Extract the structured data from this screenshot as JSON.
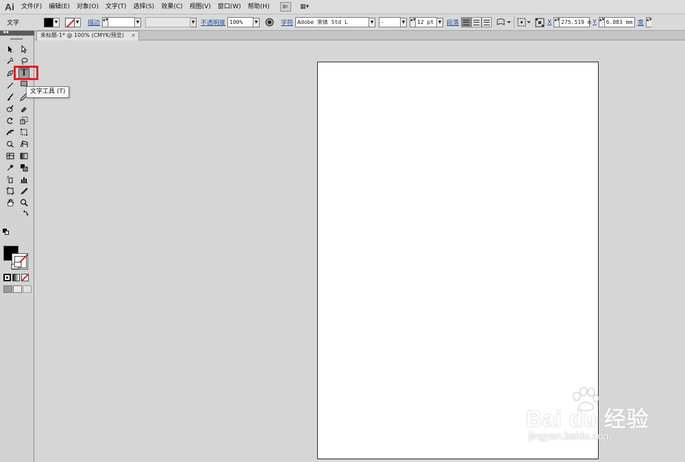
{
  "app": {
    "logo": "Ai"
  },
  "menu": {
    "items": [
      "文件(F)",
      "编辑(E)",
      "对象(O)",
      "文字(T)",
      "选择(S)",
      "效果(C)",
      "视图(V)",
      "窗口(W)",
      "帮助(H)"
    ],
    "bridge_icon": "Br",
    "workspace_icon": "▦▾"
  },
  "control": {
    "tool_label": "文字",
    "stroke_label": "描边",
    "stroke_arrows": "▲▼",
    "opacity_label": "不透明度",
    "opacity_value": "100%",
    "char_label": "字符",
    "font_family": "Adobe 宋体 Std L",
    "font_style": "-",
    "font_size": "12 pt",
    "paragraph_label": "段落",
    "x_label": "X",
    "x_value": "275.519 m",
    "y_label": "Y",
    "y_value": "6.083 mm",
    "w_label": "宽"
  },
  "document": {
    "tab_title": "未标题-1* @ 100% (CMYK/预览)",
    "close_glyph": "×"
  },
  "tools_panel": {
    "collapse_glyph": "◂◂",
    "type_tool_glyph": "T",
    "tooltip": "文字工具 (T)",
    "colors": {
      "fill": "#000000",
      "stroke": "none",
      "highlight": "#e81a24"
    }
  },
  "watermark": {
    "main": "Bai du 经验",
    "sub": "jingyan.baidu.com"
  }
}
